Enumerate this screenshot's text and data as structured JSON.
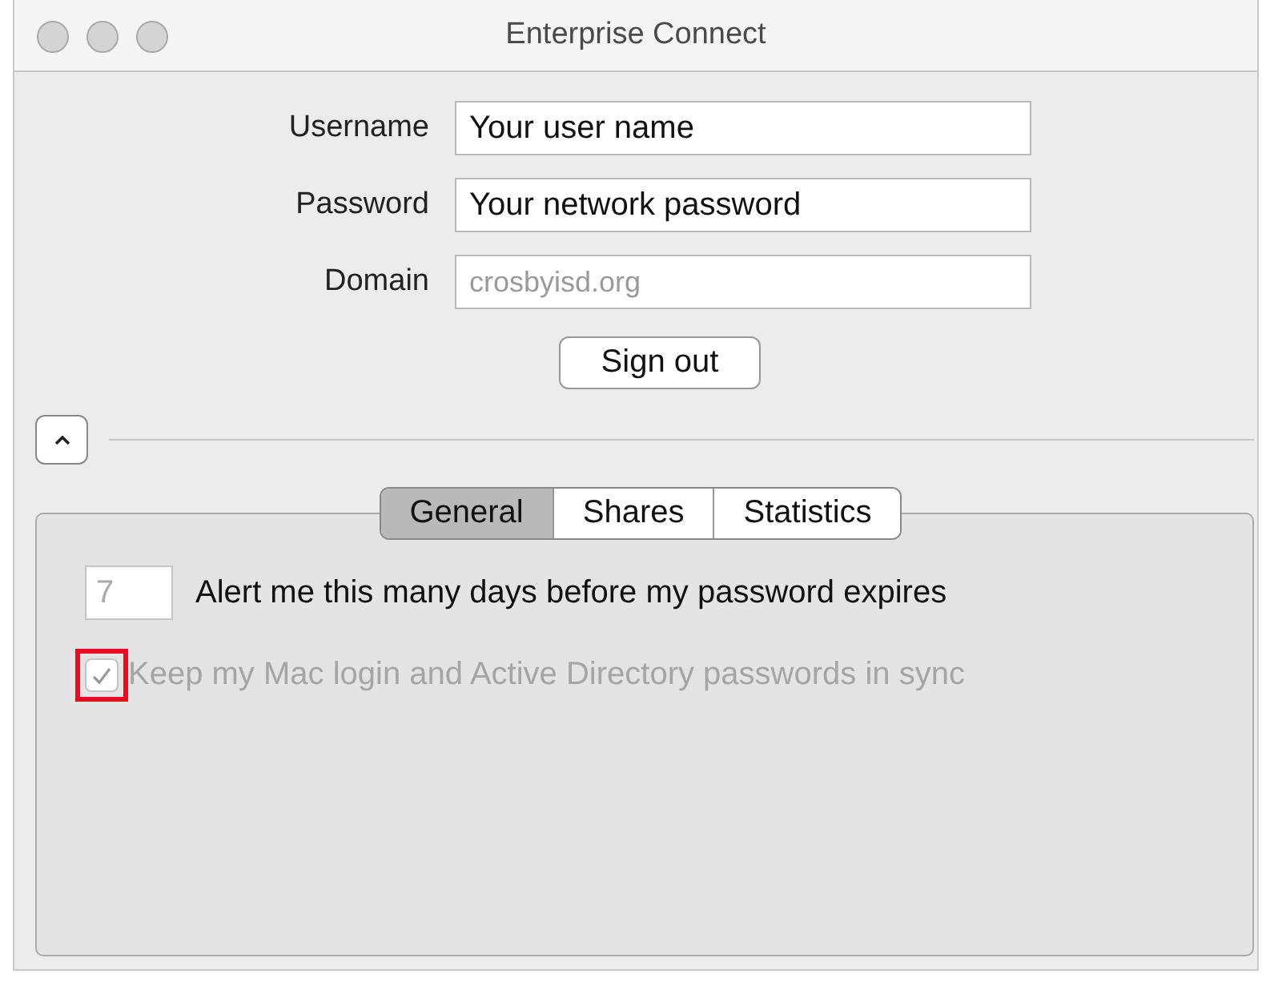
{
  "window": {
    "title": "Enterprise Connect"
  },
  "fields": [
    {
      "label": "Username",
      "value": "Your user name"
    },
    {
      "label": "Password",
      "value": "Your network password"
    },
    {
      "label": "Domain",
      "placeholder": "crosbyisd.org"
    }
  ],
  "sign_out_button": "Sign out",
  "disclosure": {
    "expanded": true
  },
  "tabs": [
    {
      "label": "General",
      "selected": true
    },
    {
      "label": "Shares",
      "selected": false
    },
    {
      "label": "Statistics",
      "selected": false
    }
  ],
  "general": {
    "alert_days": {
      "placeholder": "7",
      "label": "Alert me this many days before my password expires"
    },
    "sync": {
      "label": "Keep my Mac login and Active Directory passwords in sync",
      "checked": true,
      "disabled": true,
      "highlighted": true
    }
  }
}
